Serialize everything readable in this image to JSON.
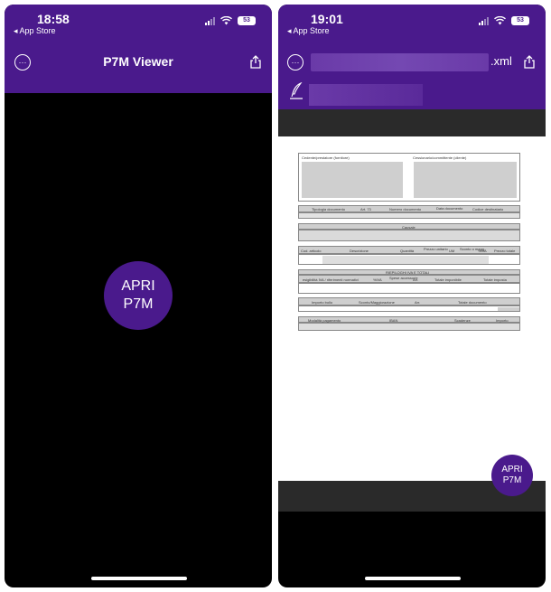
{
  "left_screen": {
    "status": {
      "time": "18:58",
      "back_label": "◂ App Store",
      "battery": "53"
    },
    "header": {
      "title": "P7M Viewer"
    },
    "open_button": {
      "line1": "APRI",
      "line2": "P7M"
    }
  },
  "right_screen": {
    "status": {
      "time": "19:01",
      "back_label": "◂ App Store",
      "battery": "53"
    },
    "header": {
      "file_extension": ".xml"
    },
    "document": {
      "seller_label": "Cedente/prestatore (fornitore)",
      "buyer_label": "Cessionario/committente (cliente)",
      "doc_type_label": "Tipologia documento",
      "art73_label": "Art. 73",
      "doc_number_label": "Numero documento",
      "doc_date_label": "Data documento",
      "dest_code_label": "Codice destinatario",
      "reason_label": "Causale",
      "article_code_label": "Cod. articolo",
      "description_label": "Descrizione",
      "quantity_label": "Quantità",
      "unit_price_label": "Prezzo unitario",
      "um_label": "UM",
      "discount_label": "Sconto o magg.",
      "vat_label": "%IVA",
      "total_price_label": "Prezzo totale",
      "summary_title": "RIEPILOGHI IVA E TOTALI",
      "tax_nature_label": "esigibilità IVA / riferimenti normativi",
      "vat2_label": "%IVA",
      "spese_label": "Spese accessorie",
      "arr_label": "Arr.",
      "taxable_total_label": "Totale imponibile",
      "tax_total_label": "Totale imposta",
      "stamp_label": "Importo bollo",
      "sconto_label": "Sconto/Maggiorazione",
      "arr2_label": "Arr.",
      "doc_total_label": "Totale documento",
      "payment_mode_label": "Modalità pagamento",
      "iban_label": "IBAN",
      "due_label": "Scadenze",
      "amount_label": "Importo"
    },
    "open_button": {
      "line1": "APRI",
      "line2": "P7M"
    }
  },
  "colors": {
    "header_purple": "#4a1a8c",
    "background": "#000000"
  }
}
